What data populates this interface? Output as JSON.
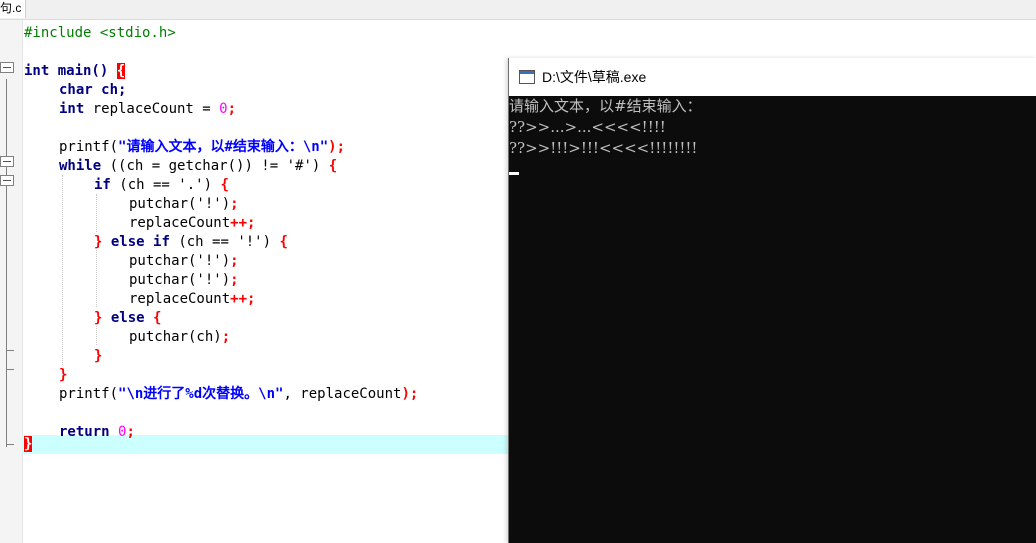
{
  "editor": {
    "tab_label": "句.c",
    "code": {
      "include": "#include <stdio.h>",
      "main_sig": "int main() ",
      "open_brace": "{",
      "char_decl": "char ch;",
      "int_decl_kw": "int ",
      "int_decl_rest": "replaceCount = ",
      "zero": "0",
      "semi": ";",
      "printf_kw": "printf(",
      "prompt_str": "\"请输入文本，以#结束输入：\\n\"",
      "close_call": ");",
      "while_kw": "while",
      "while_cond": " ((ch = getchar()) != '#') ",
      "if_kw": "if",
      "if_cond": " (ch == '.') ",
      "putchar_bang": "putchar('!')",
      "replace_inc": "replaceCount",
      "inc_op": "++",
      "else_kw": "else",
      "elseif_cond": " (ch == '!') ",
      "putchar_ch": "putchar(ch)",
      "close_brace": "}",
      "result_str": "\"\\n进行了%d次替换。\\n\"",
      "result_args": ", replaceCount",
      "return_kw": "return",
      "return_val": " 0"
    }
  },
  "console": {
    "title": "D:\\文件\\草稿.exe",
    "output_lines": [
      "请输入文本，以#结束输入：",
      "??>>...>...<<<<!!!!",
      "??>>!!!>!!!<<<<!!!!!!!!"
    ]
  },
  "colors": {
    "keyword": "#000080",
    "string": "#0000ff",
    "number": "#ff00ff",
    "operator": "#ff0000",
    "preprocessor": "#008000",
    "current_line": "#ccffff",
    "console_bg": "#0c0c0c",
    "console_text": "#c0c0c0"
  }
}
